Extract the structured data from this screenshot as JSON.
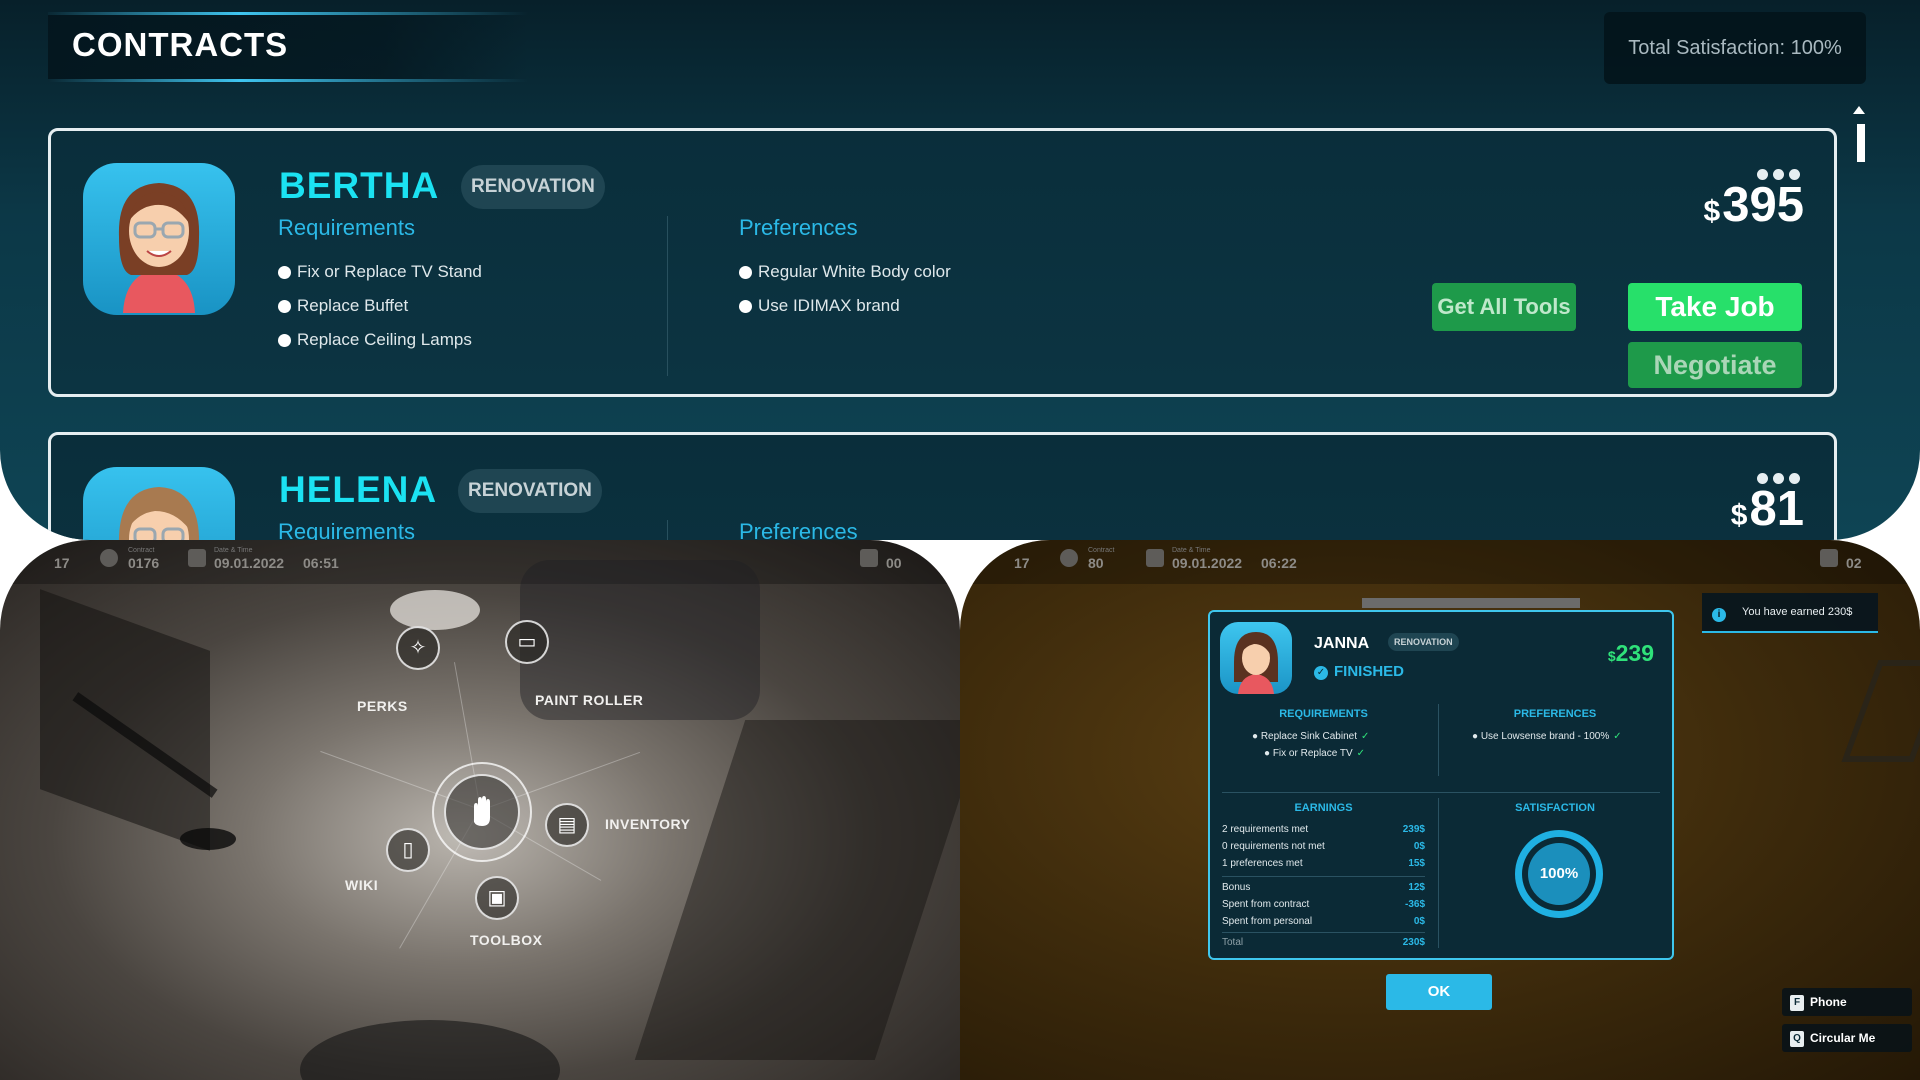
{
  "contracts": {
    "title": "CONTRACTS",
    "total_satisfaction": "Total Satisfaction: 100%",
    "cards": [
      {
        "name": "BERTHA",
        "job_type": "RENOVATION",
        "requirements_label": "Requirements",
        "requirements": [
          "Fix or Replace TV Stand",
          "Replace Buffet",
          "Replace Ceiling Lamps"
        ],
        "preferences_label": "Preferences",
        "preferences": [
          "Regular White Body color",
          "Use IDIMAX brand"
        ],
        "currency": "$",
        "price": "395",
        "buttons": {
          "get_all_tools": "Get All Tools",
          "take_job": "Take Job",
          "negotiate": "Negotiate"
        }
      },
      {
        "name": "HELENA",
        "job_type": "RENOVATION",
        "requirements_label": "Requirements",
        "preferences_label": "Preferences",
        "currency": "$",
        "price": "81"
      }
    ]
  },
  "circular_menu": {
    "hud": {
      "contract_value": "0176",
      "date": "09.01.2022",
      "time": "06:51",
      "contract_label": "Contract",
      "date_label": "Date & Time",
      "left_fragment": "17",
      "right_fragment": "00"
    },
    "items": {
      "perks": "PERKS",
      "paint_roller": "PAINT ROLLER",
      "inventory": "INVENTORY",
      "toolbox": "TOOLBOX",
      "wiki": "WIKI"
    }
  },
  "finished_job": {
    "hud": {
      "contract_value": "80",
      "date": "09.01.2022",
      "time": "06:22",
      "contract_label": "Contract",
      "date_label": "Date & Time",
      "left_fragment": "17",
      "right_fragment": "02"
    },
    "client": "JANNA",
    "job_type": "RENOVATION",
    "status": "FINISHED",
    "currency": "$",
    "price": "239",
    "requirements_head": "REQUIREMENTS",
    "requirements": [
      "Replace Sink Cabinet",
      "Fix or Replace TV"
    ],
    "preferences_head": "PREFERENCES",
    "preferences": [
      "Use Lowsense brand - 100%"
    ],
    "earnings_head": "EARNINGS",
    "earnings": [
      {
        "label": "2 requirements met",
        "value": "239$"
      },
      {
        "label": "0 requirements not met",
        "value": "0$"
      },
      {
        "label": "1 preferences met",
        "value": "15$"
      },
      {
        "label": "Bonus",
        "value": "12$"
      },
      {
        "label": "Spent from contract",
        "value": "-36$"
      },
      {
        "label": "Spent from personal",
        "value": "0$"
      },
      {
        "label": "Total",
        "value": "230$"
      }
    ],
    "satisfaction_head": "SATISFACTION",
    "satisfaction": "100%",
    "ok_label": "OK",
    "toast": "You have earned 230$",
    "key_hints": [
      {
        "key": "F",
        "label": "Phone"
      },
      {
        "key": "Q",
        "label": "Circular Me"
      }
    ]
  },
  "colors": {
    "accent_cyan": "#1be2f2",
    "accent_blue": "#2bb9e7",
    "green": "#27e06a",
    "dark_green": "#1e9a4a"
  }
}
